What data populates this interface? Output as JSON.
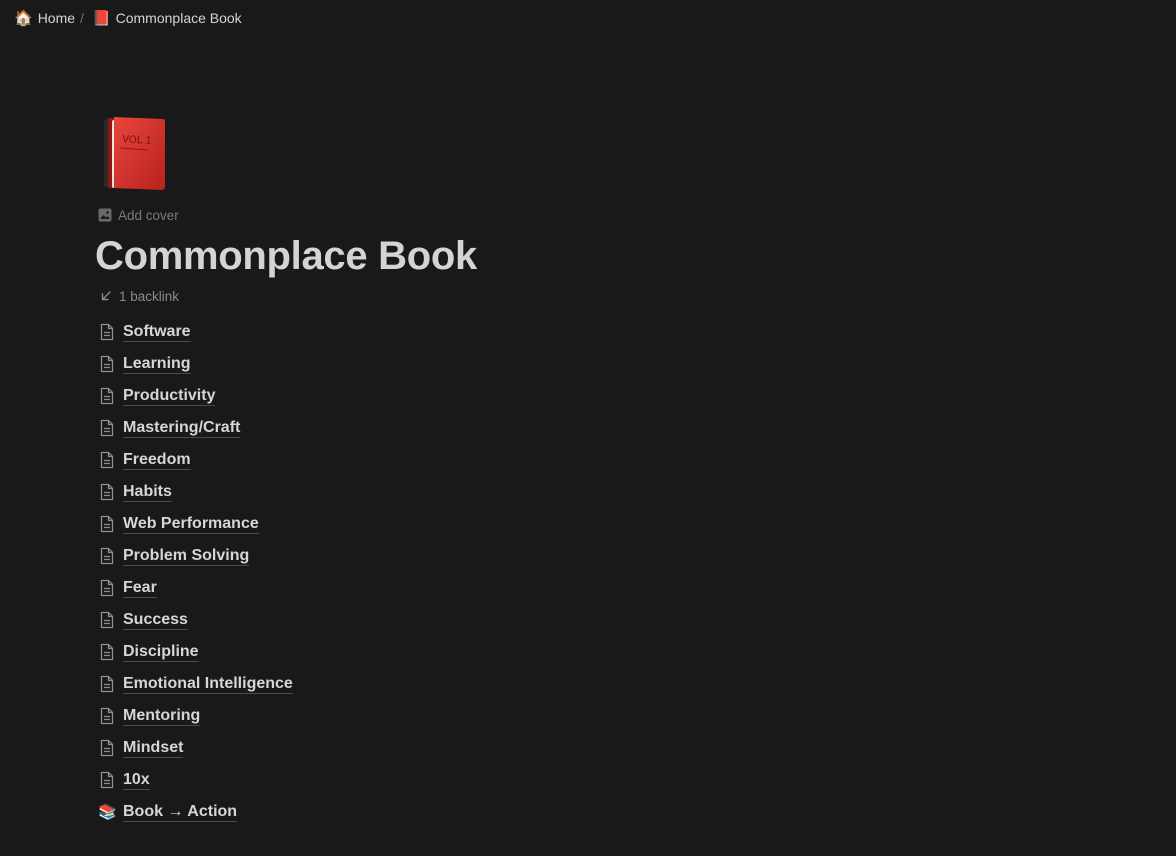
{
  "breadcrumb": {
    "home": {
      "emoji": "🏠",
      "label": "Home"
    },
    "separator": "/",
    "current": {
      "emoji": "📕",
      "label": "Commonplace Book"
    }
  },
  "page": {
    "icon": "red-book-icon",
    "add_cover_label": "Add cover",
    "title": "Commonplace Book",
    "backlink_label": "1 backlink"
  },
  "sub_pages": [
    {
      "label": "Software",
      "icon": "document-icon"
    },
    {
      "label": "Learning",
      "icon": "document-icon"
    },
    {
      "label": "Productivity",
      "icon": "document-icon"
    },
    {
      "label": "Mastering/Craft",
      "icon": "document-icon"
    },
    {
      "label": "Freedom",
      "icon": "document-icon"
    },
    {
      "label": "Habits",
      "icon": "document-icon"
    },
    {
      "label": "Web Performance",
      "icon": "document-icon"
    },
    {
      "label": "Problem Solving",
      "icon": "document-icon"
    },
    {
      "label": "Fear",
      "icon": "document-icon"
    },
    {
      "label": "Success",
      "icon": "document-icon"
    },
    {
      "label": "Discipline",
      "icon": "document-icon"
    },
    {
      "label": "Emotional Intelligence",
      "icon": "document-icon"
    },
    {
      "label": "Mentoring",
      "icon": "document-icon"
    },
    {
      "label": "Mindset",
      "icon": "document-icon"
    },
    {
      "label": "10x",
      "icon": "document-icon"
    },
    {
      "label": "Book → Action",
      "icon": "books-emoji",
      "emoji": "📚"
    }
  ],
  "colors": {
    "background": "#191919",
    "text": "#d4d4d4",
    "muted": "#7a7a7a",
    "book_red": "#d8312c"
  }
}
